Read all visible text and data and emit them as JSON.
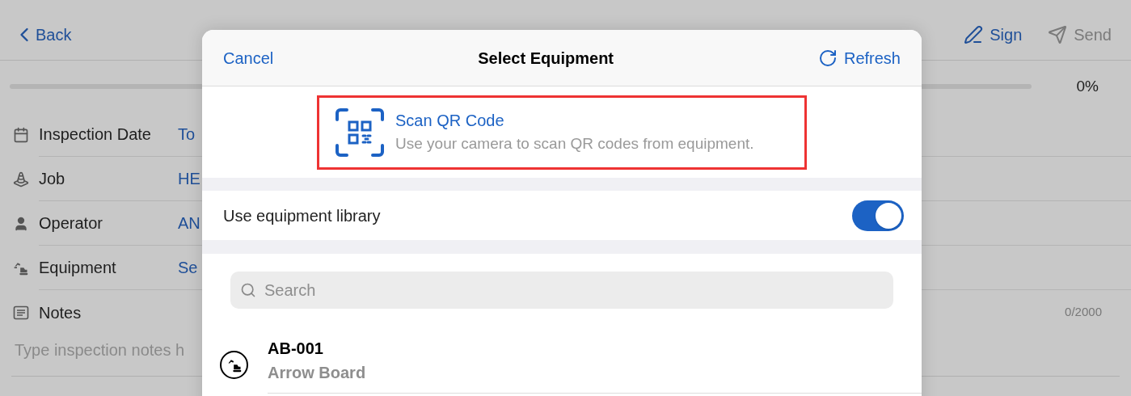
{
  "nav": {
    "back": "Back",
    "actions": [
      {
        "kind": "sign",
        "label": "Sign",
        "disabled": false
      },
      {
        "kind": "send",
        "label": "Send",
        "disabled": true
      }
    ]
  },
  "progress": {
    "level": 0,
    "reading": "0%"
  },
  "fields": [
    {
      "kind": "calendar",
      "label": "Inspection Date",
      "value": "To"
    },
    {
      "kind": "cone",
      "label": "Job",
      "value": "HE"
    },
    {
      "kind": "person",
      "label": "Operator",
      "value": "AN"
    },
    {
      "kind": "excavator",
      "label": "Equipment",
      "value": "Se"
    }
  ],
  "notes": {
    "label": "Notes",
    "counter": "0/2000",
    "placeholder": "Type inspection notes h"
  },
  "modal": {
    "cancel": "Cancel",
    "title": "Select Equipment",
    "refresh": "Refresh",
    "scan": {
      "title": "Scan QR Code",
      "subtitle": "Use your camera to scan QR codes from equipment."
    },
    "library_toggle": {
      "label": "Use equipment library",
      "on": true
    },
    "search": {
      "placeholder": "Search"
    },
    "items": [
      {
        "code": "AB-001",
        "name": "Arrow Board"
      }
    ]
  }
}
